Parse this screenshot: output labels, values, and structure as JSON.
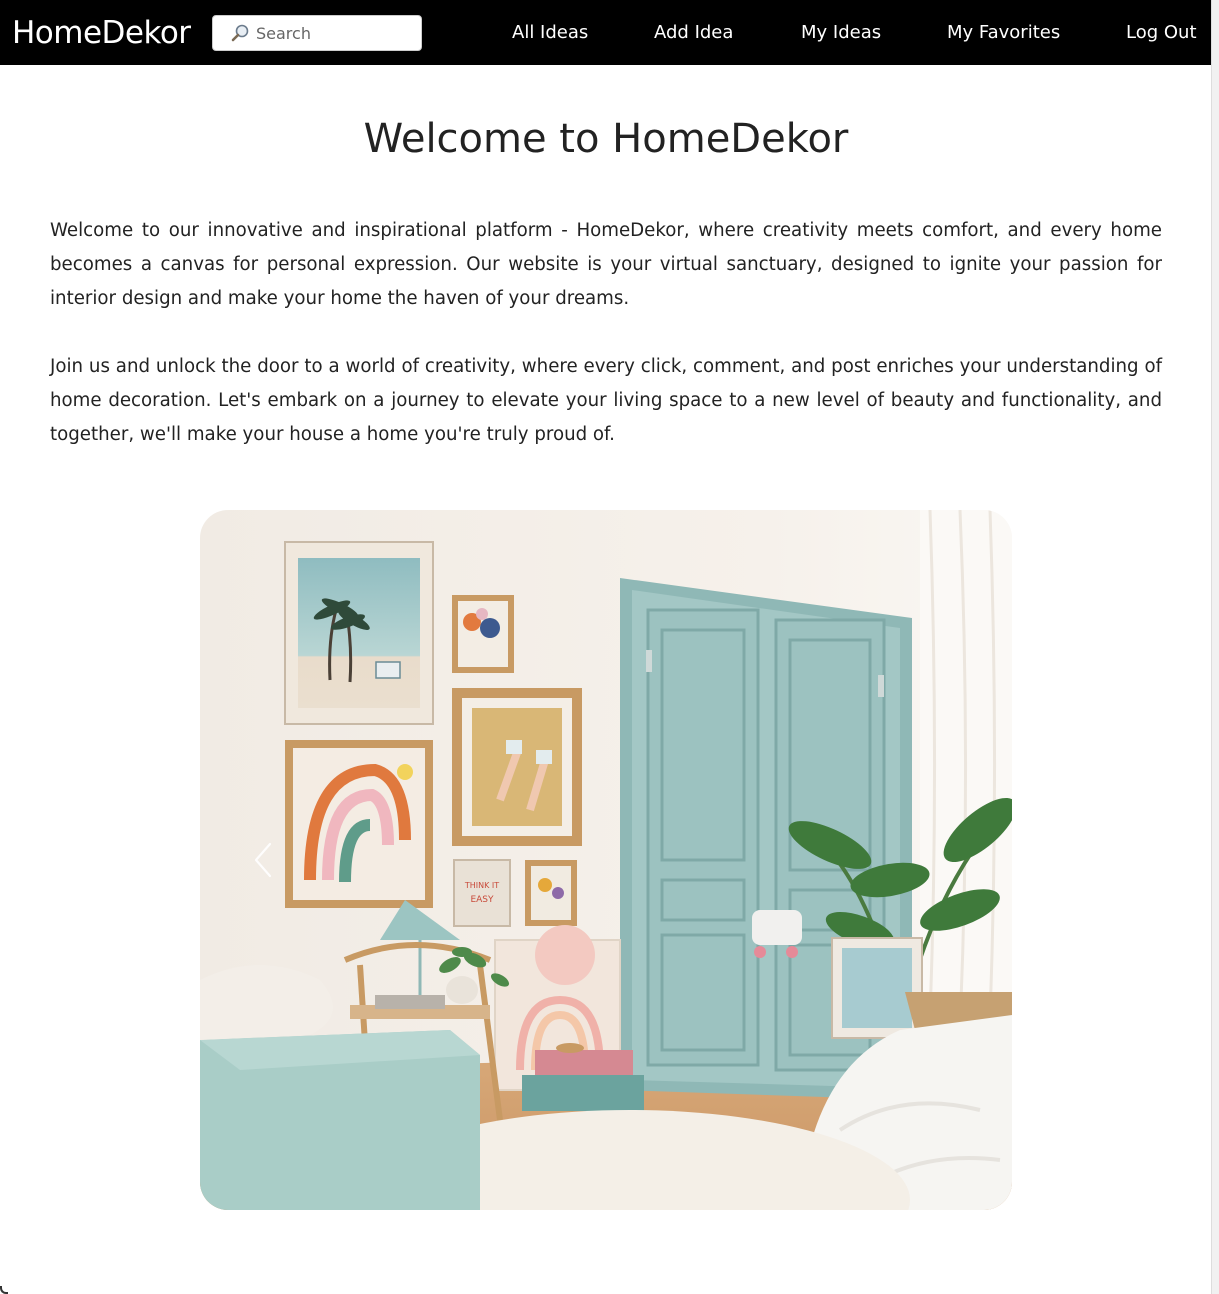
{
  "navbar": {
    "brand": "HomeDekor",
    "search": {
      "placeholder": "Search",
      "value": "",
      "icon": "search-icon"
    },
    "links": [
      {
        "label": "All Ideas"
      },
      {
        "label": "Add Idea"
      },
      {
        "label": "My Ideas"
      },
      {
        "label": "My Favorites"
      },
      {
        "label": "Log Out"
      }
    ],
    "background": "#000000",
    "text_color": "#ffffff"
  },
  "main": {
    "title": "Welcome to HomeDekor",
    "paragraphs": [
      "Welcome to our innovative and inspirational platform - HomeDekor, where creativity meets comfort, and every home becomes a canvas for personal expression. Our website is your virtual sanctuary, designed to ignite your passion for interior design and make your home the haven of your dreams.",
      "Join us and unlock the door to a world of creativity, where every click, comment, and post enriches your understanding of home decoration. Let's embark on a journey to elevate your living space to a new level of beauty and functionality, and together, we'll make your house a home you're truly proud of."
    ]
  },
  "carousel": {
    "prev_icon": "chevron-left-icon",
    "image_colors": {
      "wall": "#f3ede6",
      "door": "#9fc4c2",
      "sofa": "#a9cdc7",
      "floor": "#d9a877",
      "rug": "#f4efe7"
    },
    "poster_text": "THINK IT EASY"
  }
}
